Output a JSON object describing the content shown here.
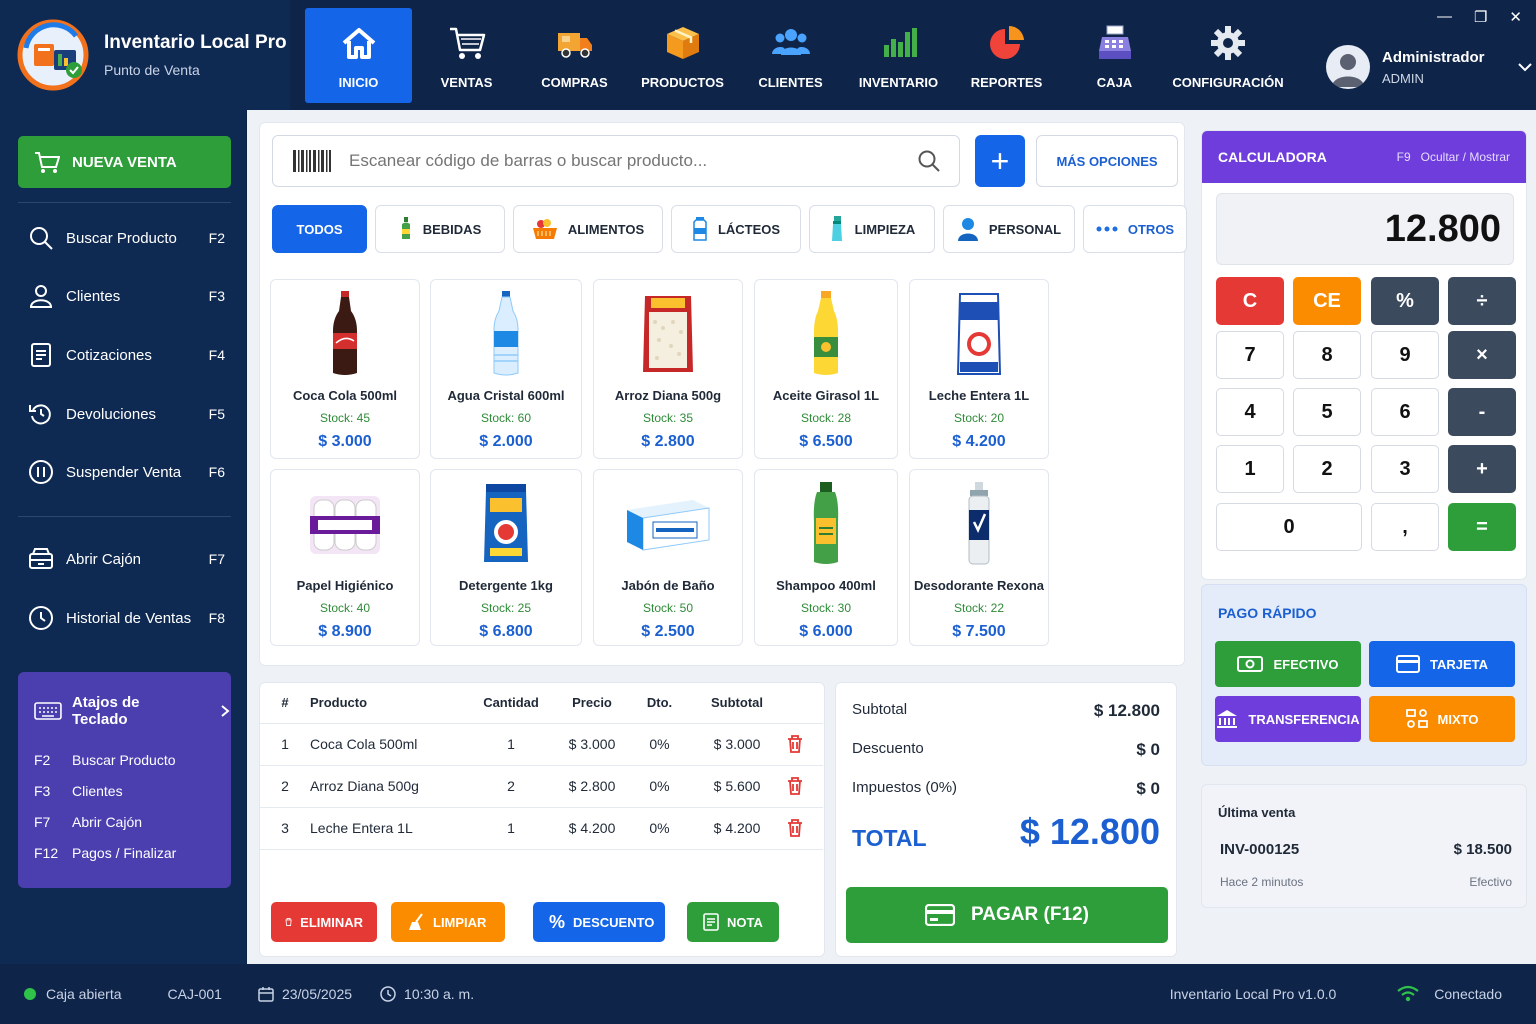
{
  "app": {
    "title": "Inventario Local Pro",
    "subtitle": "Punto de Venta"
  },
  "nav": [
    {
      "label": "INICIO",
      "icon": "home-icon",
      "active": true
    },
    {
      "label": "VENTAS",
      "icon": "cart-icon"
    },
    {
      "label": "COMPRAS",
      "icon": "truck-icon"
    },
    {
      "label": "PRODUCTOS",
      "icon": "box-icon"
    },
    {
      "label": "CLIENTES",
      "icon": "users-icon"
    },
    {
      "label": "INVENTARIO",
      "icon": "bar-chart-icon"
    },
    {
      "label": "REPORTES",
      "icon": "pie-chart-icon"
    },
    {
      "label": "CAJA",
      "icon": "cash-register-icon"
    },
    {
      "label": "CONFIGURACIÓN",
      "icon": "gear-icon"
    }
  ],
  "user": {
    "name": "Administrador",
    "role": "ADMIN"
  },
  "window_controls": {
    "minimize": "—",
    "restore": "❐",
    "close": "✕"
  },
  "sidebar": {
    "new_sale": "NUEVA VENTA",
    "items": [
      {
        "label": "Buscar Producto",
        "key": "F2",
        "icon": "search-icon"
      },
      {
        "label": "Clientes",
        "key": "F3",
        "icon": "user-icon"
      },
      {
        "label": "Cotizaciones",
        "key": "F4",
        "icon": "document-icon"
      },
      {
        "label": "Devoluciones",
        "key": "F5",
        "icon": "return-icon"
      },
      {
        "label": "Suspender Venta",
        "key": "F6",
        "icon": "pause-icon"
      },
      {
        "label": "Abrir Cajón",
        "key": "F7",
        "icon": "drawer-icon"
      },
      {
        "label": "Historial de Ventas",
        "key": "F8",
        "icon": "clock-icon"
      }
    ],
    "shortcuts": {
      "title": "Atajos de Teclado",
      "rows": [
        {
          "key": "F2",
          "label": "Buscar Producto"
        },
        {
          "key": "F3",
          "label": "Clientes"
        },
        {
          "key": "F7",
          "label": "Abrir Cajón"
        },
        {
          "key": "F12",
          "label": "Pagos / Finalizar"
        }
      ]
    }
  },
  "search": {
    "placeholder": "Escanear código de barras o buscar producto...",
    "add_label": "+",
    "more_options": "MÁS OPCIONES"
  },
  "categories": [
    {
      "label": "TODOS",
      "active": true
    },
    {
      "label": "BEBIDAS",
      "icon": "bottle-icon"
    },
    {
      "label": "ALIMENTOS",
      "icon": "basket-icon"
    },
    {
      "label": "LÁCTEOS",
      "icon": "milk-icon"
    },
    {
      "label": "LIMPIEZA",
      "icon": "spray-icon"
    },
    {
      "label": "PERSONAL",
      "icon": "person-icon"
    },
    {
      "label": "OTROS",
      "icon": "dots-icon"
    }
  ],
  "products": [
    {
      "name": "Coca Cola 500ml",
      "stock": "Stock: 45",
      "price": "$ 3.000"
    },
    {
      "name": "Agua Cristal 600ml",
      "stock": "Stock: 60",
      "price": "$ 2.000"
    },
    {
      "name": "Arroz Diana 500g",
      "stock": "Stock: 35",
      "price": "$ 2.800"
    },
    {
      "name": "Aceite Girasol 1L",
      "stock": "Stock: 28",
      "price": "$ 6.500"
    },
    {
      "name": "Leche Entera 1L",
      "stock": "Stock: 20",
      "price": "$ 4.200"
    },
    {
      "name": "Papel Higiénico",
      "stock": "Stock: 40",
      "price": "$ 8.900"
    },
    {
      "name": "Detergente 1kg",
      "stock": "Stock: 25",
      "price": "$ 6.800"
    },
    {
      "name": "Jabón de Baño",
      "stock": "Stock: 50",
      "price": "$ 2.500"
    },
    {
      "name": "Shampoo 400ml",
      "stock": "Stock: 30",
      "price": "$ 6.000"
    },
    {
      "name": "Desodorante Rexona",
      "stock": "Stock: 22",
      "price": "$ 7.500"
    }
  ],
  "cart": {
    "headers": [
      "#",
      "Producto",
      "Cantidad",
      "Precio",
      "Dto.",
      "Subtotal"
    ],
    "rows": [
      {
        "n": "1",
        "product": "Coca Cola 500ml",
        "qty": "1",
        "price": "$ 3.000",
        "disc": "0%",
        "subtotal": "$ 3.000"
      },
      {
        "n": "2",
        "product": "Arroz Diana 500g",
        "qty": "2",
        "price": "$ 2.800",
        "disc": "0%",
        "subtotal": "$ 5.600"
      },
      {
        "n": "3",
        "product": "Leche Entera 1L",
        "qty": "1",
        "price": "$ 4.200",
        "disc": "0%",
        "subtotal": "$ 4.200"
      }
    ]
  },
  "actions": {
    "delete": "ELIMINAR",
    "clear": "LIMPIAR",
    "discount": "DESCUENTO",
    "note": "NOTA"
  },
  "totals": {
    "subtotal_label": "Subtotal",
    "subtotal": "$ 12.800",
    "discount_label": "Descuento",
    "discount": "$ 0",
    "tax_label": "Impuestos (0%)",
    "tax": "$ 0",
    "total_label": "TOTAL",
    "total": "$ 12.800",
    "pay_label": "PAGAR (F12)"
  },
  "calculator": {
    "title": "CALCULADORA",
    "key": "F9",
    "toggle": "Ocultar / Mostrar",
    "display": "12.800",
    "keys": [
      "C",
      "CE",
      "%",
      "÷",
      "7",
      "8",
      "9",
      "×",
      "4",
      "5",
      "6",
      "-",
      "1",
      "2",
      "3",
      "+",
      "0",
      ",",
      "="
    ]
  },
  "quick_pay": {
    "title": "PAGO RÁPIDO",
    "cash": "EFECTIVO",
    "card": "TARJETA",
    "transfer": "TRANSFERENCIA",
    "mixed": "MIXTO"
  },
  "last_sale": {
    "title": "Última venta",
    "invoice": "INV-000125",
    "amount": "$ 18.500",
    "time": "Hace 2 minutos",
    "method": "Efectivo"
  },
  "status": {
    "register": "Caja abierta",
    "register_id": "CAJ-001",
    "date": "23/05/2025",
    "time": "10:30 a. m.",
    "version": "Inventario Local Pro v1.0.0",
    "connection": "Conectado"
  },
  "colors": {
    "primary": "#1565e8",
    "success": "#2e9e3a",
    "danger": "#e53935",
    "warning": "#fb8c00",
    "purple": "#6f3ddb",
    "navy": "#0e2449"
  }
}
